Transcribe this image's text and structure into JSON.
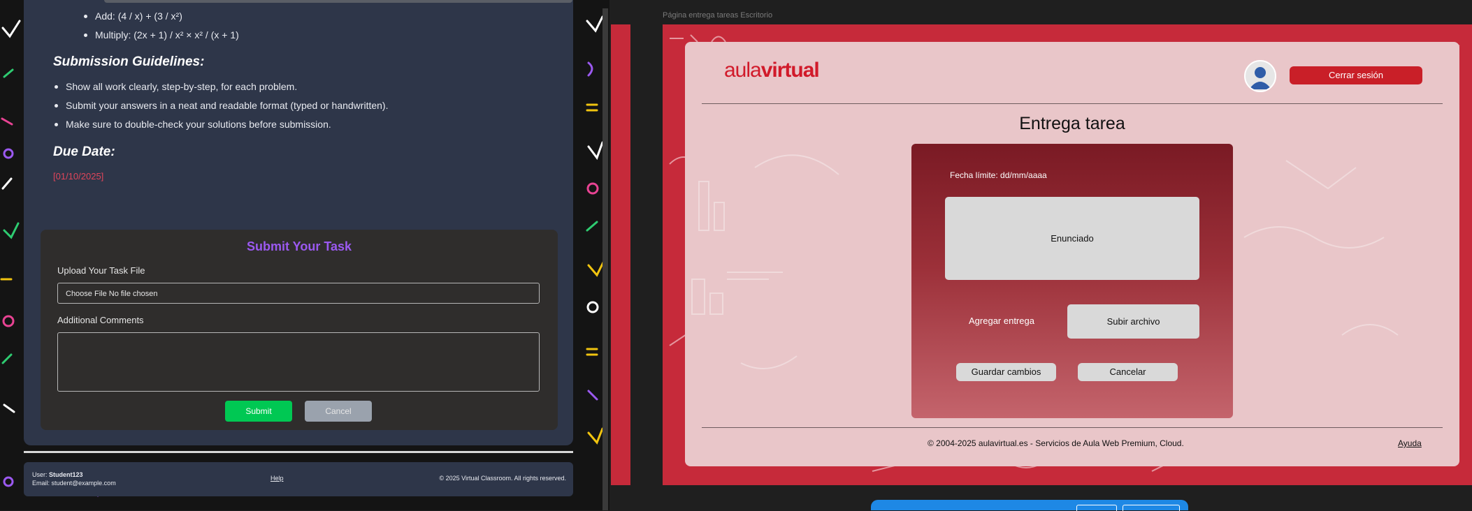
{
  "left": {
    "operations": [
      "Add: (4 / x) + (3 / x²)",
      "Multiply: (2x + 1) / x² × x² / (x + 1)"
    ],
    "guidelines_heading": "Submission Guidelines:",
    "guidelines": [
      "Show all work clearly, step-by-step, for each problem.",
      "Submit your answers in a neat and readable format (typed or handwritten).",
      "Make sure to double-check your solutions before submission."
    ],
    "due_heading": "Due Date:",
    "due_date": "[01/10/2025]",
    "submit": {
      "title": "Submit Your Task",
      "upload_label": "Upload Your Task File",
      "file_value": "Choose File No file chosen",
      "comments_label": "Additional Comments",
      "comments_value": "",
      "submit_label": "Submit",
      "cancel_label": "Cancel"
    },
    "footer": {
      "user_prefix": "User: ",
      "user_name": "Student123",
      "email": "Email: student@example.com",
      "help": "Help",
      "copyright": "© 2025 Virtual Classroom. All rights reserved."
    }
  },
  "right": {
    "frame_title": "Página entrega tareas Escritorio",
    "logo_part1": "aula",
    "logo_part2": "virtual",
    "logout": "Cerrar sesión",
    "title": "Entrega tarea",
    "deadline": "Fecha límite: dd/mm/aaaa",
    "statement": "Enunciado",
    "add_delivery": "Agregar entrega",
    "upload": "Subir archivo",
    "save": "Guardar cambios",
    "cancel": "Cancelar",
    "footer_copy": "© 2004-2025 aulavirtual.es - Servicios de Aula Web Premium, Cloud.",
    "footer_help": "Ayuda"
  },
  "colors": {
    "accent_purple": "#9b59f0",
    "submit_green": "#00c853",
    "due_red": "#e0455a",
    "brand_red": "#c91f28",
    "card_navy": "#2e3649"
  },
  "icons": [
    "user-avatar-icon"
  ]
}
